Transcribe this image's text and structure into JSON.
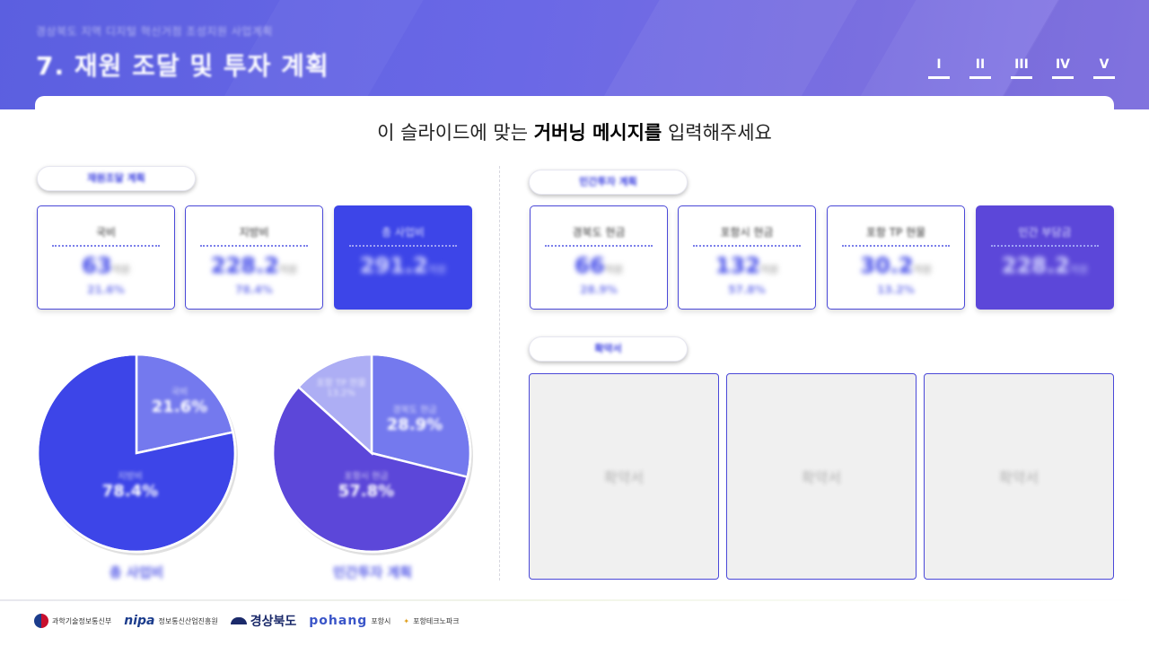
{
  "header": {
    "subtitle": "경상북도 지역 디지털 혁신거점 조성지원 사업계획",
    "title": "7. 재원 조달 및 투자 계획",
    "nav": [
      "I",
      "II",
      "III",
      "IV",
      "V"
    ]
  },
  "message": {
    "before": "이 슬라이드에 맞는 ",
    "bold": "거버닝 메시지를",
    "after": " 입력해주세요"
  },
  "left": {
    "section_label": "재원조달 계획",
    "cards": [
      {
        "label": "국비",
        "value": "63",
        "unit": "억원",
        "pct": "21.6%"
      },
      {
        "label": "지방비",
        "value": "228.2",
        "unit": "억원",
        "pct": "78.4%"
      },
      {
        "label": "총 사업비",
        "value": "291.2",
        "unit": "억원",
        "pct": ""
      }
    ]
  },
  "right": {
    "section_label": "민간투자 계획",
    "cards": [
      {
        "label": "경북도 현금",
        "value": "66",
        "unit": "억원",
        "pct": "28.9%"
      },
      {
        "label": "포항시 현금",
        "value": "132",
        "unit": "억원",
        "pct": "57.8%"
      },
      {
        "label": "포항 TP 현물",
        "value": "30.2",
        "unit": "억원",
        "pct": "13.2%"
      },
      {
        "label": "민간 부담금",
        "value": "228.2",
        "unit": "억원",
        "pct": ""
      }
    ],
    "sample_label": "확약서",
    "samples": [
      "확약서",
      "확약서",
      "확약서"
    ]
  },
  "pies": {
    "left_title": "총 사업비",
    "right_title": "민간투자 계획",
    "left_labels": [
      {
        "name": "국비",
        "pct": "21.6%"
      },
      {
        "name": "지방비",
        "pct": "78.4%"
      }
    ],
    "right_labels": [
      {
        "name": "경북도 현금",
        "pct": "28.9%"
      },
      {
        "name": "포항시 현금",
        "pct": "57.8%"
      },
      {
        "name": "포항 TP 현물",
        "pct": "13.2%"
      }
    ]
  },
  "chart_data": [
    {
      "type": "pie",
      "title": "총 사업비",
      "categories": [
        "국비",
        "지방비"
      ],
      "values": [
        21.6,
        78.4
      ],
      "colors": [
        "#7479ee",
        "#3d45e8"
      ]
    },
    {
      "type": "pie",
      "title": "민간투자 계획",
      "categories": [
        "경북도 현금",
        "포항시 현금",
        "포항 TP 현물"
      ],
      "values": [
        28.9,
        57.8,
        13.3
      ],
      "colors": [
        "#7479ee",
        "#5c47d9",
        "#adaef4"
      ]
    }
  ],
  "footer": {
    "logos": [
      "과학기술정보통신부",
      "nipa",
      "정보통신산업진흥원",
      "경상북도",
      "pohang",
      "포항시",
      "포항테크노파크"
    ]
  }
}
